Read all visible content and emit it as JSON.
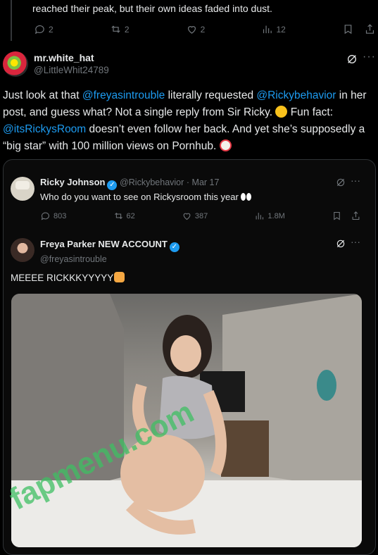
{
  "prev_post": {
    "text": "reached their peak, but their own ideas faded into dust.",
    "actions": {
      "replies": "2",
      "reposts": "2",
      "likes": "2",
      "views": "12"
    }
  },
  "post": {
    "name": "mr.white_hat",
    "handle": "@LittleWhit24789",
    "text_1": "Just look at that ",
    "mention_1": "@freyasintrouble",
    "text_2": " literally requested ",
    "mention_2": "@Rickybehavior",
    "text_3": " in her post, and guess what? Not a single reply from Sir Ricky. ",
    "text_4": " Fun fact: ",
    "mention_3": "@itsRickysRoom",
    "text_5": " doesn’t even follow her back. And yet she’s supposedly a “big star” with 100 million views on Pornhub. "
  },
  "quote_1": {
    "name": "Ricky Johnson",
    "handle": "@Rickybehavior",
    "date": "· Mar 17",
    "text": "Who do you want to see on Rickysroom this year",
    "actions": {
      "replies": "803",
      "reposts": "62",
      "likes": "387",
      "views": "1.8M"
    }
  },
  "quote_2": {
    "name": "Freya Parker NEW ACCOUNT",
    "handle": "@freyasintrouble",
    "text": "MEEEE RICKKKYYYYY"
  },
  "watermark": "fapmenu.com",
  "colors": {
    "link": "#1d9bf0",
    "background": "#000000",
    "muted": "#71767b",
    "watermark": "#3fbf63"
  }
}
